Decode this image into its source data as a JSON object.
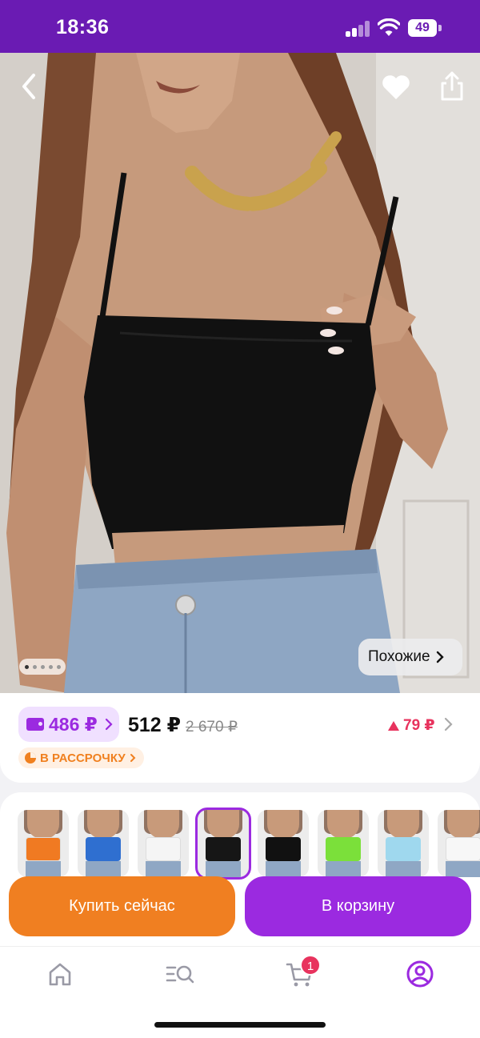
{
  "status_bar": {
    "time": "18:36",
    "battery": "49"
  },
  "product": {
    "gallery": {
      "dots_total": 5,
      "active_dot": 1
    },
    "similar_label": "Похожие"
  },
  "pricing": {
    "wallet_price": "486 ₽",
    "price": "512 ₽",
    "old_price": "2 670 ₽",
    "bonus": "79 ₽",
    "installment_label": "В РАССРОЧКУ"
  },
  "variants": [
    {
      "name": "orange",
      "color": "#f07a22"
    },
    {
      "name": "blue",
      "color": "#2f6fd0"
    },
    {
      "name": "white",
      "color": "#f5f5f5"
    },
    {
      "name": "black",
      "color": "#161616",
      "selected": true
    },
    {
      "name": "black-long",
      "color": "#111111"
    },
    {
      "name": "green",
      "color": "#7be03a"
    },
    {
      "name": "light-blue",
      "color": "#9fd8ee"
    },
    {
      "name": "white-long",
      "color": "#f7f7f7"
    }
  ],
  "actions": {
    "buy_now": "Купить сейчас",
    "add_to_cart": "В корзину"
  },
  "tab_bar": {
    "items": [
      {
        "name": "home",
        "icon": "home-icon"
      },
      {
        "name": "catalog",
        "icon": "catalog-search-icon"
      },
      {
        "name": "cart",
        "icon": "cart-icon",
        "badge": "1"
      },
      {
        "name": "profile",
        "icon": "profile-icon",
        "active": true
      }
    ]
  },
  "colors": {
    "brand_purple": "#9b2ae0",
    "status_bar": "#6a1bb3",
    "accent_orange": "#f07f21",
    "bonus_red": "#e8335e"
  }
}
